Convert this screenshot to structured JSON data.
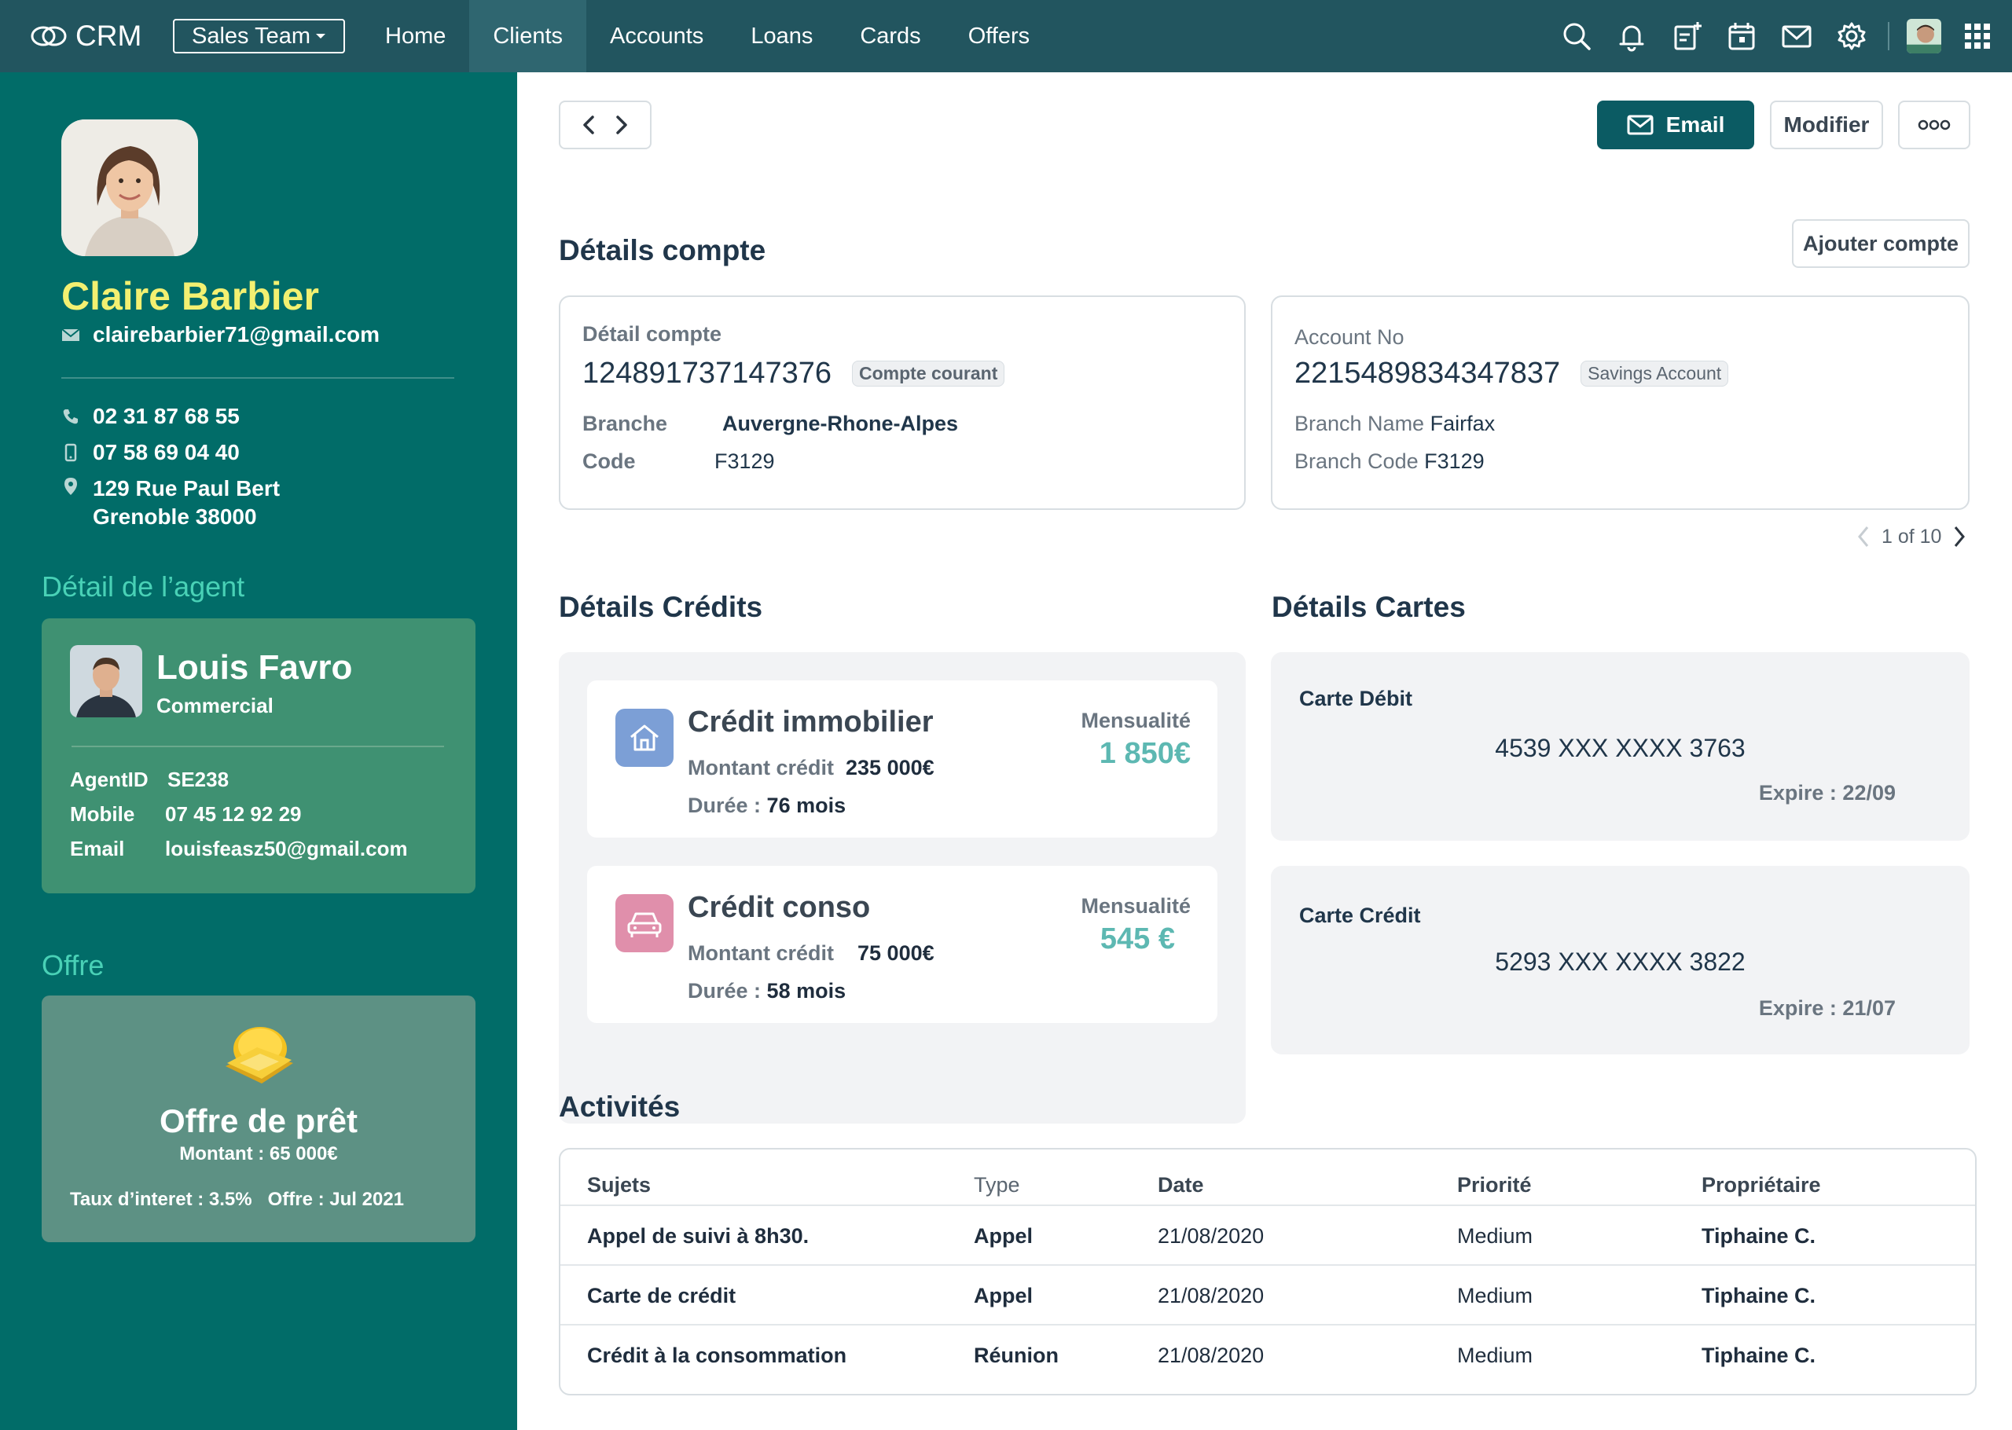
{
  "topbar": {
    "brand": "CRM",
    "team_select": "Sales Team",
    "nav": [
      "Home",
      "Clients",
      "Accounts",
      "Loans",
      "Cards",
      "Offers"
    ],
    "active_nav": "Clients",
    "more": "•••"
  },
  "client": {
    "name": "Claire Barbier",
    "email": "clairebarbier71@gmail.com",
    "phone": "02 31 87 68 55",
    "mobile": "07 58 69 04 40",
    "address_line1": "129  Rue Paul Bert",
    "address_line2": "Grenoble 38000"
  },
  "agent": {
    "section_title": "Détail de l’agent",
    "name": "Louis Favro",
    "role": "Commercial",
    "id_label": "AgentID",
    "id": "SE238",
    "mobile_label": "Mobile",
    "mobile": "07 45 12 92 29",
    "email_label": "Email",
    "email": "louisfeasz50@gmail.com"
  },
  "offer": {
    "section_title": "Offre",
    "title": "Offre de prêt",
    "amount": "Montant : 65 000€",
    "terms": "Taux d’interet : 3.5%   Offre : Jul 2021"
  },
  "actions": {
    "email": "Email",
    "edit": "Modifier",
    "more": "ooo",
    "add_account": "Ajouter compte"
  },
  "accounts": {
    "title": "Détails compte",
    "cards": [
      {
        "label": "Détail compte",
        "number": "124891737147376",
        "type": "Compte courant",
        "branch_label": "Branche",
        "branch": "Auvergne-Rhone-Alpes",
        "code_label": "Code",
        "code": "F3129"
      },
      {
        "label": "Account No",
        "number": "2215489834347837",
        "type": "Savings Account",
        "branch_label": "Branch Name",
        "branch": "Fairfax",
        "code_label": "Branch Code",
        "code": "F3129"
      }
    ],
    "pager": "1 of 10"
  },
  "credits": {
    "title": "Détails Crédits",
    "items": [
      {
        "name": "Crédit immobilier",
        "amount_label": "Montant crédit",
        "amount": "235 000€",
        "duration_label": "Durée :",
        "duration": "76 mois",
        "monthly_label": "Mensualité",
        "monthly": "1 850€",
        "icon": "house-icon",
        "icon_color": "#7c9fd6"
      },
      {
        "name": "Crédit conso",
        "amount_label": "Montant crédit",
        "amount": "75 000€",
        "duration_label": "Durée :",
        "duration": "58 mois",
        "monthly_label": "Mensualité",
        "monthly": "545 €",
        "icon": "car-icon",
        "icon_color": "#e08fab"
      }
    ]
  },
  "cards": {
    "title": "Détails Cartes",
    "items": [
      {
        "type": "Carte Débit",
        "number": "4539 XXX XXXX 3763",
        "expiry": "Expire : 22/09"
      },
      {
        "type": "Carte Crédit",
        "number": "5293 XXX XXXX 3822",
        "expiry": "Expire : 21/07"
      }
    ]
  },
  "activities": {
    "title": "Activités",
    "columns": [
      "Sujets",
      "Type",
      "Date",
      "Priorité",
      "Propriétaire"
    ],
    "rows": [
      [
        "Appel de suivi à 8h30.",
        "Appel",
        "21/08/2020",
        "Medium",
        "Tiphaine C."
      ],
      [
        "Carte de crédit",
        "Appel",
        "21/08/2020",
        "Medium",
        "Tiphaine C."
      ],
      [
        "Crédit à la consommation",
        "Réunion",
        "21/08/2020",
        "Medium",
        "Tiphaine C."
      ]
    ]
  },
  "colors": {
    "topbar": "#22555f",
    "sidebar": "#016c68",
    "accent": "#0b5b63",
    "name": "#f3f071",
    "section": "#49d1b6",
    "monthly": "#5db8b2"
  }
}
